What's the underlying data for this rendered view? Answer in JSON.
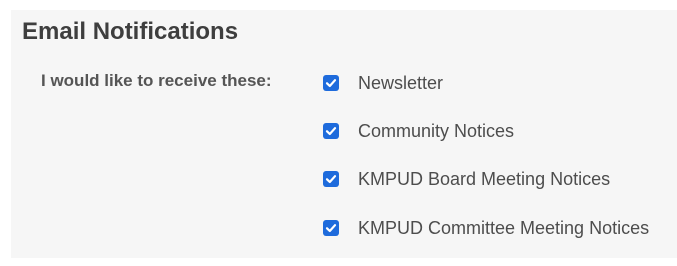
{
  "section": {
    "title": "Email Notifications",
    "field_label": "I would like to receive these:",
    "accent_color": "#1e6bdc",
    "options": [
      {
        "label": "Newsletter",
        "checked": true
      },
      {
        "label": "Community Notices",
        "checked": true
      },
      {
        "label": "KMPUD Board Meeting Notices",
        "checked": true
      },
      {
        "label": "KMPUD Committee Meeting Notices",
        "checked": true
      }
    ]
  }
}
